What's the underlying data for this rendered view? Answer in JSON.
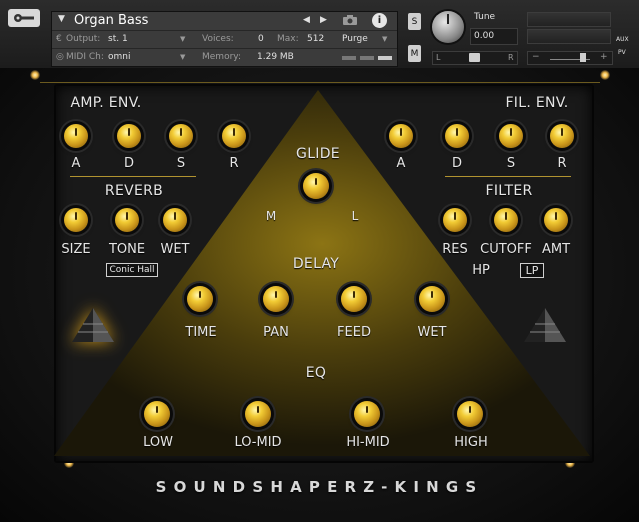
{
  "header": {
    "instrument_name": "Organ Bass",
    "output_label": "Output:",
    "output_value": "st. 1",
    "voices_label": "Voices:",
    "voices_value": "0",
    "max_label": "Max:",
    "max_value": "512",
    "purge_label": "Purge",
    "midi_label": "MIDI Ch:",
    "midi_value": "omni",
    "memory_label": "Memory:",
    "memory_value": "1.29 MB",
    "solo_label": "S",
    "mute_label": "M",
    "tune_label": "Tune",
    "tune_value": "0.00",
    "pan_left": "L",
    "pan_right": "R",
    "aux_label": "AUX",
    "pv_label": "PV",
    "vol_minus": "−",
    "vol_plus": "+"
  },
  "sections": {
    "amp_env": {
      "title": "AMP. ENV.",
      "knobs": [
        "A",
        "D",
        "S",
        "R"
      ]
    },
    "fil_env": {
      "title": "FIL. ENV.",
      "knobs": [
        "A",
        "D",
        "S",
        "R"
      ]
    },
    "reverb": {
      "title": "REVERB",
      "knobs": [
        "SIZE",
        "TONE",
        "WET"
      ],
      "preset": "Conic Hall"
    },
    "filter": {
      "title": "FILTER",
      "knobs": [
        "RES",
        "CUTOFF",
        "AMT"
      ],
      "mode_hp": "HP",
      "mode_lp": "LP"
    },
    "glide": {
      "title": "GLIDE",
      "left": "M",
      "right": "L"
    },
    "delay": {
      "title": "DELAY",
      "knobs": [
        "TIME",
        "PAN",
        "FEED",
        "WET"
      ]
    },
    "eq": {
      "title": "EQ",
      "knobs": [
        "LOW",
        "LO-MID",
        "HI-MID",
        "HIGH"
      ]
    }
  },
  "brand": "SOUNDSHAPERZ-KINGS",
  "colors": {
    "gold": "#e8b92a",
    "panel": "#191919",
    "text": "#e6e6e6"
  }
}
